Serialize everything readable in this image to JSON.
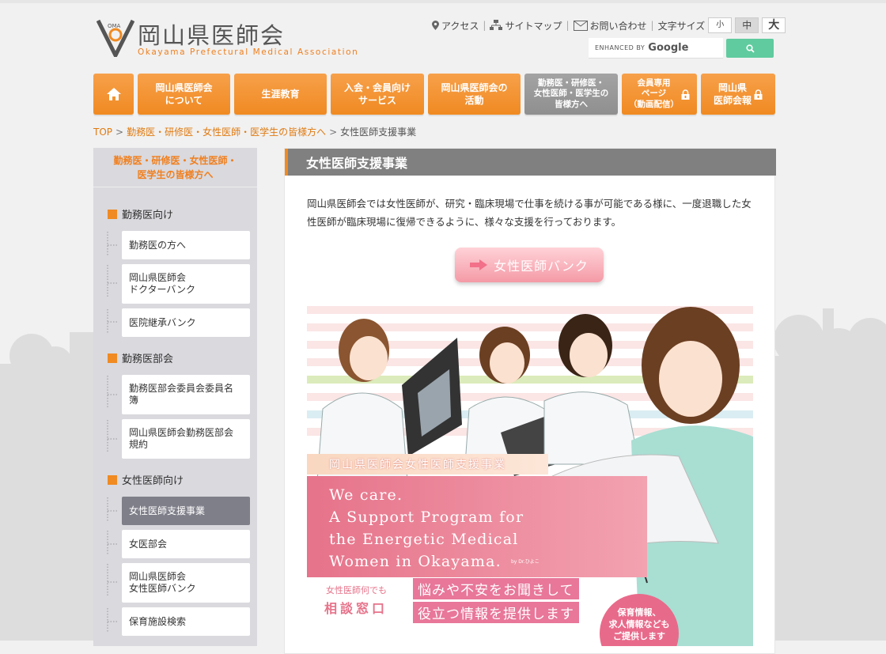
{
  "header": {
    "logo_mark": "OMA",
    "logo_title": "岡山県医師会",
    "logo_subtitle": "Okayama Prefectural Medical Association",
    "utility": {
      "access": "アクセス",
      "sitemap": "サイトマップ",
      "contact": "お問い合わせ",
      "font_size_label": "文字サイズ",
      "font_small": "小",
      "font_medium": "中",
      "font_large": "大"
    },
    "search": {
      "enhanced_by": "ENHANCED BY",
      "google": "Google"
    }
  },
  "nav": {
    "items": [
      {
        "label": "岡山県医師会\nについて"
      },
      {
        "label": "生涯教育"
      },
      {
        "label": "入会・会員向け\nサービス"
      },
      {
        "label": "岡山県医師会の\n活動"
      },
      {
        "label": "勤務医・研修医・\n女性医師・医学生の\n皆様方へ"
      },
      {
        "label": "会員専用\nページ\n（動画配信）"
      },
      {
        "label": "岡山県\n医師会報"
      }
    ]
  },
  "breadcrumb": {
    "home": "TOP",
    "parent": "勤務医・研修医・女性医師・医学生の皆様方へ",
    "current": "女性医師支援事業"
  },
  "sidebar": {
    "heading": "勤務医・研修医・女性医師・\n医学生の皆様方へ",
    "sections": [
      {
        "title": "勤務医向け",
        "items": [
          "勤務医の方へ",
          "岡山県医師会\nドクターバンク",
          "医院継承バンク"
        ]
      },
      {
        "title": "勤務医部会",
        "items": [
          "勤務医部会委員会委員名\n簿",
          "岡山県医師会勤務医部会\n規約"
        ]
      },
      {
        "title": "女性医師向け",
        "items": [
          "女性医師支援事業",
          "女医部会",
          "岡山県医師会\n女性医師バンク",
          "保育施設検索"
        ]
      }
    ]
  },
  "main": {
    "title": "女性医師支援事業",
    "intro": "岡山県医師会では女性医師が、研究・臨床現場で仕事を続ける事が可能である様に、一度退職した女性医師が臨床現場に復帰できるように、様々な支援を行っております。",
    "bank_button": "女性医師バンク",
    "banner": {
      "jp_title": "岡山県医師会女性医師支援事業",
      "en_text": "We care.\nA Support Program for\nthe Energetic Medical\nWomen in Okayama.",
      "by": "by Dr.ひよこ",
      "consult_small": "女性医師何でも",
      "consult_big": "相談窓口",
      "tag1": "悩みや不安をお聞きして",
      "tag2": "役立つ情報を提供します",
      "circle_text": "保育情報、\n求人情報なども\nご提供します"
    }
  },
  "colors": {
    "accent_orange": "#f08a22",
    "nav_gray": "#8f8f8f",
    "search_green": "#5fcb9f",
    "banner_pink": "#e6738a"
  }
}
